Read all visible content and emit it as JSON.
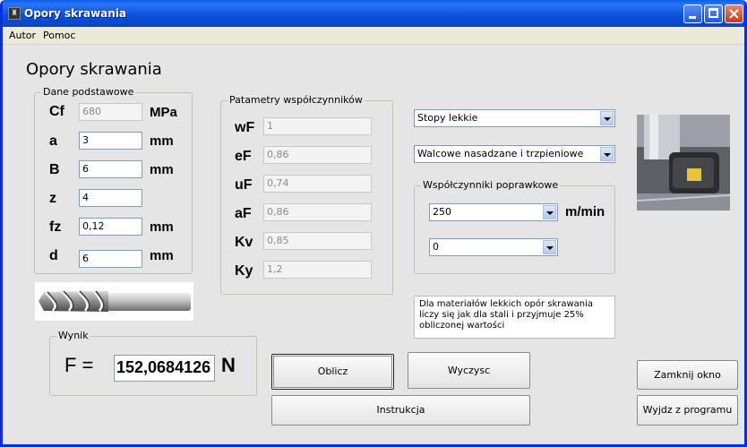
{
  "window": {
    "title": "Opory skrawania"
  },
  "menu": {
    "items": [
      "Autor",
      "Pomoc"
    ]
  },
  "heading": "Opory skrawania",
  "dane": {
    "label": "Dane podstawowe",
    "rows": [
      {
        "symbol": "Cf",
        "value": "680",
        "unit": "MPa"
      },
      {
        "symbol": "a",
        "value": "3",
        "unit": "mm"
      },
      {
        "symbol": "B",
        "value": "6",
        "unit": "mm"
      },
      {
        "symbol": "z",
        "value": "4",
        "unit": ""
      },
      {
        "symbol": "fz",
        "value": "0,12",
        "unit": "mm"
      },
      {
        "symbol": "d",
        "value": "6",
        "unit": "mm"
      }
    ]
  },
  "params": {
    "label": "Patametry współczynników",
    "rows": [
      {
        "symbol": "wF",
        "value": "1"
      },
      {
        "symbol": "eF",
        "value": "0,86"
      },
      {
        "symbol": "uF",
        "value": "0,74"
      },
      {
        "symbol": "aF",
        "value": "0,86"
      },
      {
        "symbol": "Kv",
        "value": "0,85"
      },
      {
        "symbol": "Ky",
        "value": "1,2"
      }
    ]
  },
  "material_combo": "Stopy lekkie",
  "tool_combo": "Walcowe nasadzane i trzpieniowe",
  "correction": {
    "label": "Współczynniki poprawkowe",
    "speed_combo": "250",
    "speed_unit": "m/min",
    "second_combo": "0"
  },
  "note": "Dla materiałów lekkich opór skrawania liczy się jak dla stali i przyjmuje 25% obliczonej wartości",
  "wynik": {
    "label": "Wynik",
    "prefix": "F =",
    "value": "152,0684126",
    "unit": "N"
  },
  "buttons": {
    "oblicz": "Oblicz",
    "wyczysc": "Wyczysc",
    "instrukcja": "Instrukcja",
    "zamknij": "Zamknij okno",
    "wyjdz": "Wyjdz z programu"
  }
}
